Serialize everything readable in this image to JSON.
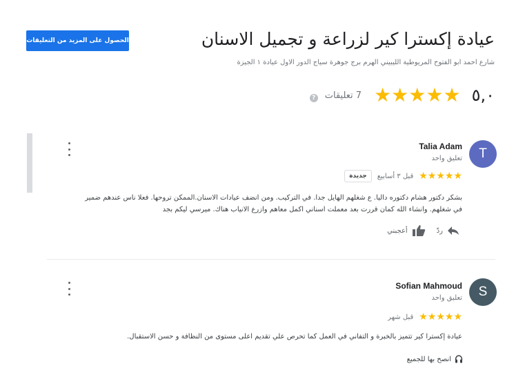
{
  "header": {
    "more_reviews_button": "الحصول على المزيد من التعليقات",
    "title": "عيادة إكسترا كير لزراعة و تجميل الاسنان",
    "address": "شارع احمد ابو الفتوح المريوطية الليبيني الهرم برج جوهرة سياج الدور الاول عيادة ١ الجيزة",
    "rating": "٥,٠",
    "stars": "★★★★★",
    "review_count": "7 تعليقات",
    "help_glyph": "?"
  },
  "reviews": [
    {
      "initial": "T",
      "avatar_color": "#5c6bc0",
      "name": "Talia Adam",
      "sub": "تعليق واحد",
      "stars": "★★★★★",
      "time": "قبل ٣ أسابيع",
      "badge": "جديدة",
      "text": "بشكر دكتور هشام دكتوره داليا. ع شغلهم الهايل جدا. في التركيب. ومن انضف عيادات الاسنان.الممكن تروحها. فعلا ناس عندهم ضمير في شغلهم. وانشاء الله كمان قررت بعد معملت اسناني اكمل معاهم وازرع الانياب هناك. ميرسي ليكم بجد",
      "reply_label": "ردّ",
      "like_label": "أعجبني"
    },
    {
      "initial": "S",
      "avatar_color": "#455a64",
      "name": "Sofian Mahmoud",
      "sub": "تعليق واحد",
      "stars": "★★★★★",
      "time": "قبل شهر",
      "text": "عيادة إكسترا كير تتميز بالخبرة و التفاني في العمل كما تحرص علي تقديم اعلى مستوى من النظافة و حسن الاستقبال.",
      "recommend_label": "انصح بها للجميع"
    }
  ],
  "colors": {
    "accent": "#1a73e8",
    "star": "#fbbc04"
  }
}
